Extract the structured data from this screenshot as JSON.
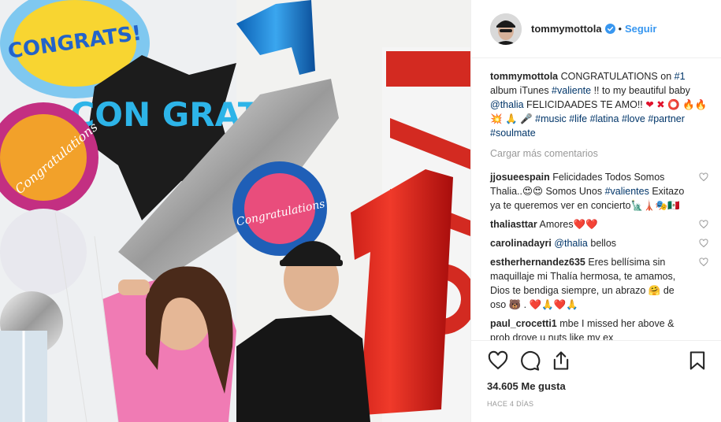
{
  "header": {
    "username": "tommymottola",
    "separator": "•",
    "follow_label": "Seguir"
  },
  "caption": {
    "username": "tommymottola",
    "t1": "CONGRATULATIONS on ",
    "tag1": "#1",
    "t2": " album iTunes ",
    "tag2": "#valiente",
    "t3": " !! to my beautiful baby ",
    "mention": "@thalia",
    "t4": " FELICIDAADES TE AMO!! ",
    "emojis": "❤ ✖ ⭕ 🔥🔥 💥 🙏 🎤",
    "tags": [
      "#music",
      "#life",
      "#latina",
      "#love",
      "#partner",
      "#soulmate"
    ]
  },
  "load_more": "Cargar más comentarios",
  "comments": [
    {
      "user": "jjosueespain",
      "parts": [
        "Felicidades Todos Somos Thalia..😍😍 Somos Unos "
      ],
      "tag": "#valientes",
      "after": " Exitazo ya te queremos ver en concierto🗽🗼🎭🇲🇽"
    },
    {
      "user": "thaliasttar",
      "parts": [
        "Amores❤️❤️"
      ],
      "tag": "",
      "after": ""
    },
    {
      "user": "carolinadayri",
      "parts": [
        ""
      ],
      "tag": "@thalia",
      "after": " bellos"
    },
    {
      "user": "estherhernandez635",
      "parts": [
        "Eres bellísima sin maquillaje mi Thalía hermosa, te amamos, Dios te bendiga siempre, un abrazo 🤗 de oso 🐻 . ❤️🙏❤️🙏"
      ],
      "tag": "",
      "after": ""
    },
    {
      "user": "paul_crocetti1",
      "parts": [
        "mbe I missed her above & prob drove u nuts like my ex"
      ],
      "tag": "",
      "after": ""
    }
  ],
  "likes": "34.605 Me gusta",
  "time_ago": "HACE 4 DÍAS",
  "photo": {
    "balloon_texts": [
      "CONGRATS!",
      "CON GRAT",
      "Congratulations",
      "Congratulations"
    ]
  },
  "colors": {
    "link": "#003569",
    "follow": "#3897f0",
    "muted": "#999999"
  }
}
